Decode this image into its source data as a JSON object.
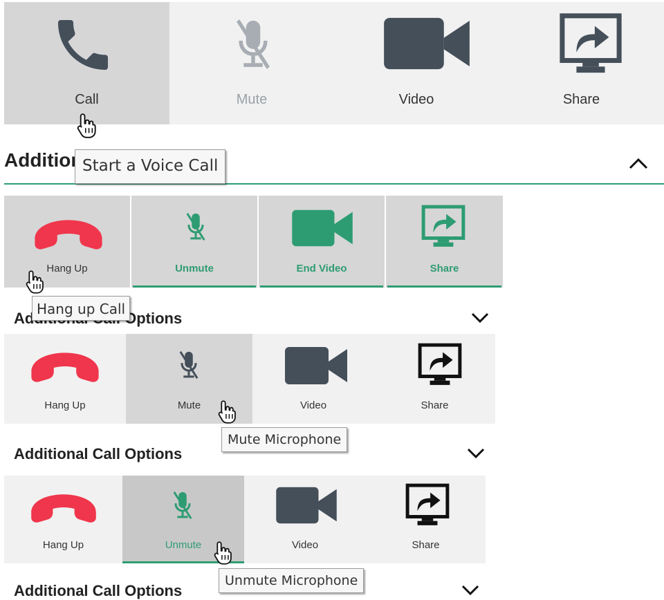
{
  "colors": {
    "icon_dark": "#444f5a",
    "icon_muted": "#a7adb3",
    "accent_green": "#2e9c73",
    "hangup_red": "#f0364c",
    "bar_bg": "#f1f1f1",
    "hover_bg": "#d6d6d6"
  },
  "panel1": {
    "call_label": "Call",
    "mute_label": "Mute",
    "video_label": "Video",
    "share_label": "Share",
    "section_title": "Additional Call Options",
    "tooltip": "Start a Voice Call"
  },
  "panel2": {
    "hangup_label": "Hang Up",
    "unmute_label": "Unmute",
    "end_video_label": "End Video",
    "share_label": "Share",
    "section_title": "Additional Call Options",
    "tooltip": "Hang up Call"
  },
  "panel3": {
    "hangup_label": "Hang Up",
    "mute_label": "Mute",
    "video_label": "Video",
    "share_label": "Share",
    "section_title": "Additional Call Options",
    "tooltip": "Mute Microphone"
  },
  "panel4": {
    "hangup_label": "Hang Up",
    "unmute_label": "Unmute",
    "video_label": "Video",
    "share_label": "Share",
    "section_title": "Additional Call Options",
    "tooltip": "Unmute Microphone"
  }
}
